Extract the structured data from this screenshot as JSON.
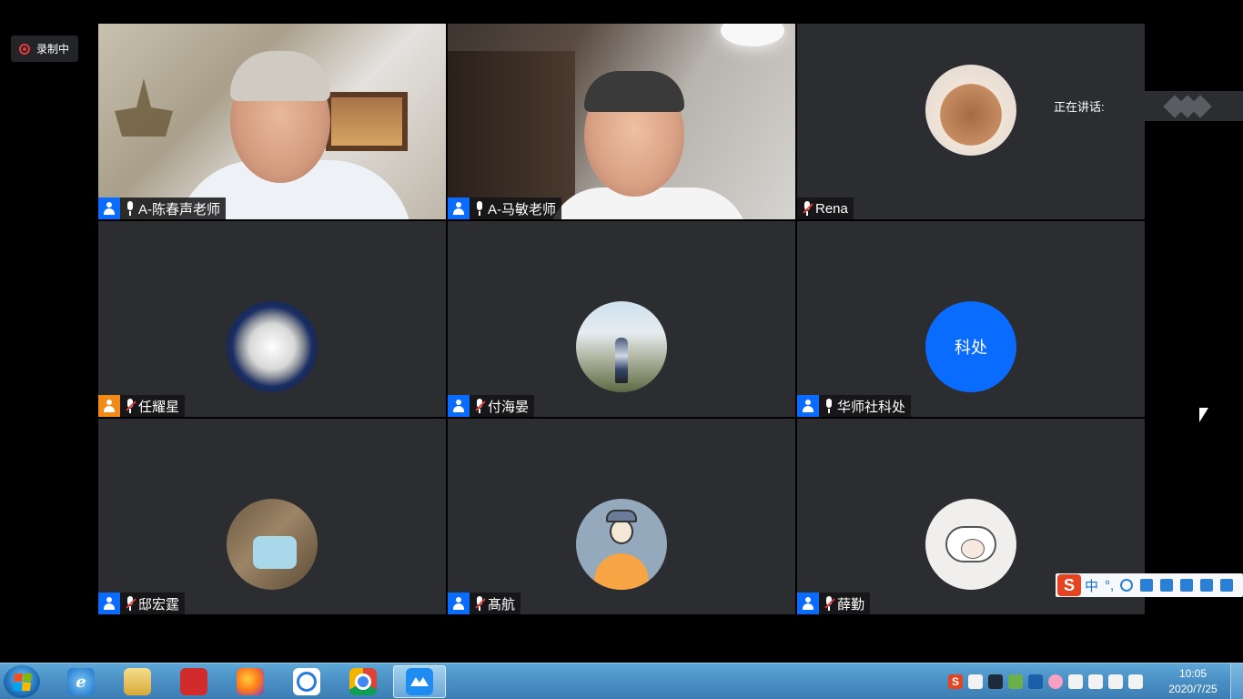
{
  "recording": {
    "label": "录制中"
  },
  "speaking": {
    "label": "正在讲话:"
  },
  "participants": [
    {
      "name": "A-陈春声老师",
      "mic": "on",
      "type": "host"
    },
    {
      "name": "A-马敏老师",
      "mic": "on",
      "type": "host"
    },
    {
      "name": "Rena",
      "mic": "muted",
      "type": "none"
    },
    {
      "name": "任耀星",
      "mic": "muted",
      "type": "guest"
    },
    {
      "name": "付海晏",
      "mic": "muted",
      "type": "host"
    },
    {
      "name": "华师社科处",
      "mic": "on",
      "type": "host",
      "avatar_text": "科处"
    },
    {
      "name": "邸宏霆",
      "mic": "muted",
      "type": "host"
    },
    {
      "name": "髙航",
      "mic": "muted",
      "type": "host"
    },
    {
      "name": "薛勤",
      "mic": "muted",
      "type": "host"
    }
  ],
  "ime": {
    "lang": "中",
    "punct": "°,"
  },
  "taskbar": {
    "apps": [
      "internet-explorer",
      "file-explorer",
      "netease-music",
      "firefox",
      "baidu-netdisk",
      "chrome",
      "tencent-meeting"
    ],
    "clock_time": "10:05",
    "clock_date": "2020/7/25"
  },
  "colors": {
    "accent": "#0a6cff",
    "guest": "#f28a18",
    "tile": "#2b2d31",
    "muted": "#e53b3b"
  }
}
